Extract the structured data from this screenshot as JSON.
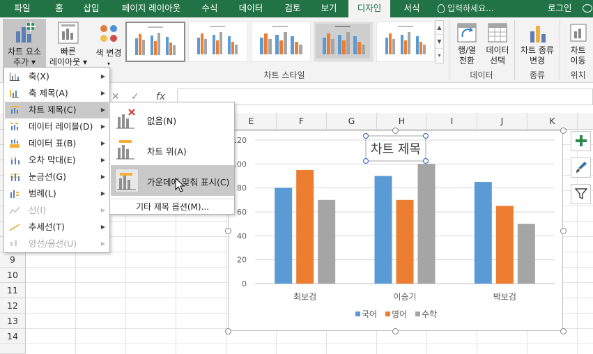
{
  "tabs": [
    {
      "label": "파일"
    },
    {
      "label": "홈"
    },
    {
      "label": "삽입"
    },
    {
      "label": "페이지 레이아웃"
    },
    {
      "label": "수식"
    },
    {
      "label": "데이터"
    },
    {
      "label": "검토"
    },
    {
      "label": "보기"
    },
    {
      "label": "디자인",
      "active": true
    },
    {
      "label": "서식"
    }
  ],
  "tell_me": "입력하세요...",
  "login": "로그인",
  "ribbon": {
    "add_element_line1": "차트 요소",
    "add_element_line2": "추가",
    "quick_layout_line1": "빠른",
    "quick_layout_line2": "레이아웃",
    "change_colors": "색 변경",
    "styles_group": "차트 스타일",
    "switch_row_col_line1": "행/열",
    "switch_row_col_line2": "전환",
    "select_data_line1": "데이터",
    "select_data_line2": "선택",
    "data_group": "데이터",
    "change_type_line1": "차트 종류",
    "change_type_line2": "변경",
    "type_group": "종류",
    "move_chart_line1": "차트",
    "move_chart_line2": "이동",
    "location_group": "위치"
  },
  "formula_bar": {
    "cancel": "✕",
    "enter": "✓",
    "fx": "fx"
  },
  "columns": [
    "E",
    "F",
    "G",
    "H",
    "I",
    "J",
    "K"
  ],
  "rows": [
    "9",
    "10",
    "11",
    "12",
    "13",
    "14"
  ],
  "menu1": {
    "items": [
      {
        "label": "축(X)",
        "arrow": "▶"
      },
      {
        "label": "축 제목(A)",
        "arrow": "▶"
      },
      {
        "label": "차트 제목(C)",
        "arrow": "▶"
      },
      {
        "label": "데이터 레이블(D)",
        "arrow": "▶"
      },
      {
        "label": "데이터 표(B)",
        "arrow": "▶"
      },
      {
        "label": "오차 막대(E)",
        "arrow": "▶"
      },
      {
        "label": "눈금선(G)",
        "arrow": "▶"
      },
      {
        "label": "범례(L)",
        "arrow": "▶"
      },
      {
        "label": "선(I)",
        "arrow": "▶"
      },
      {
        "label": "추세선(T)",
        "arrow": "▶"
      },
      {
        "label": "양선/음선(U)",
        "arrow": "▶"
      }
    ]
  },
  "menu2": {
    "items": [
      {
        "label": "없음(N)"
      },
      {
        "label": "차트 위(A)"
      },
      {
        "label": "가운데에 맞춰 표시(C)"
      }
    ],
    "more": "기타 제목 옵션(M)..."
  },
  "colors": {
    "series1": "#5b9bd5",
    "series2": "#ed7d31",
    "series3": "#a5a5a5",
    "accent": "#217346"
  },
  "chart_data": {
    "type": "bar",
    "title": "차트 제목",
    "categories": [
      "최보검",
      "이승기",
      "박보검"
    ],
    "series": [
      {
        "name": "국어",
        "values": [
          80,
          90,
          85
        ]
      },
      {
        "name": "영어",
        "values": [
          95,
          70,
          65
        ]
      },
      {
        "name": "수학",
        "values": [
          70,
          100,
          50
        ]
      }
    ],
    "ylim": [
      0,
      120
    ],
    "yticks": [
      "0",
      "20",
      "40",
      "60",
      "80",
      "100",
      "120"
    ],
    "grid": true,
    "legend": "bottom"
  }
}
